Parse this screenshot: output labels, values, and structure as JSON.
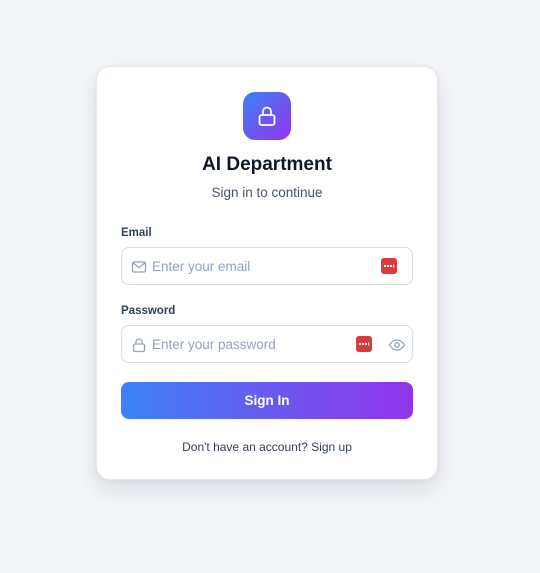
{
  "app": {
    "title": "AI Department",
    "subtitle": "Sign in to continue",
    "logo_icon": "lock-icon"
  },
  "form": {
    "email": {
      "label": "Email",
      "placeholder": "Enter your email",
      "value": "",
      "icon": "mail-icon"
    },
    "password": {
      "label": "Password",
      "placeholder": "Enter your password",
      "value": "",
      "icon": "lock-icon"
    },
    "submit_label": "Sign In"
  },
  "footer": {
    "prompt": "Don't have an account?",
    "link_label": "Sign up"
  },
  "colors": {
    "page_background": "#f3f5f9",
    "gradient_start": "#3b82f6",
    "gradient_end": "#9333ea",
    "password_manager_badge": "#d93a3a"
  }
}
